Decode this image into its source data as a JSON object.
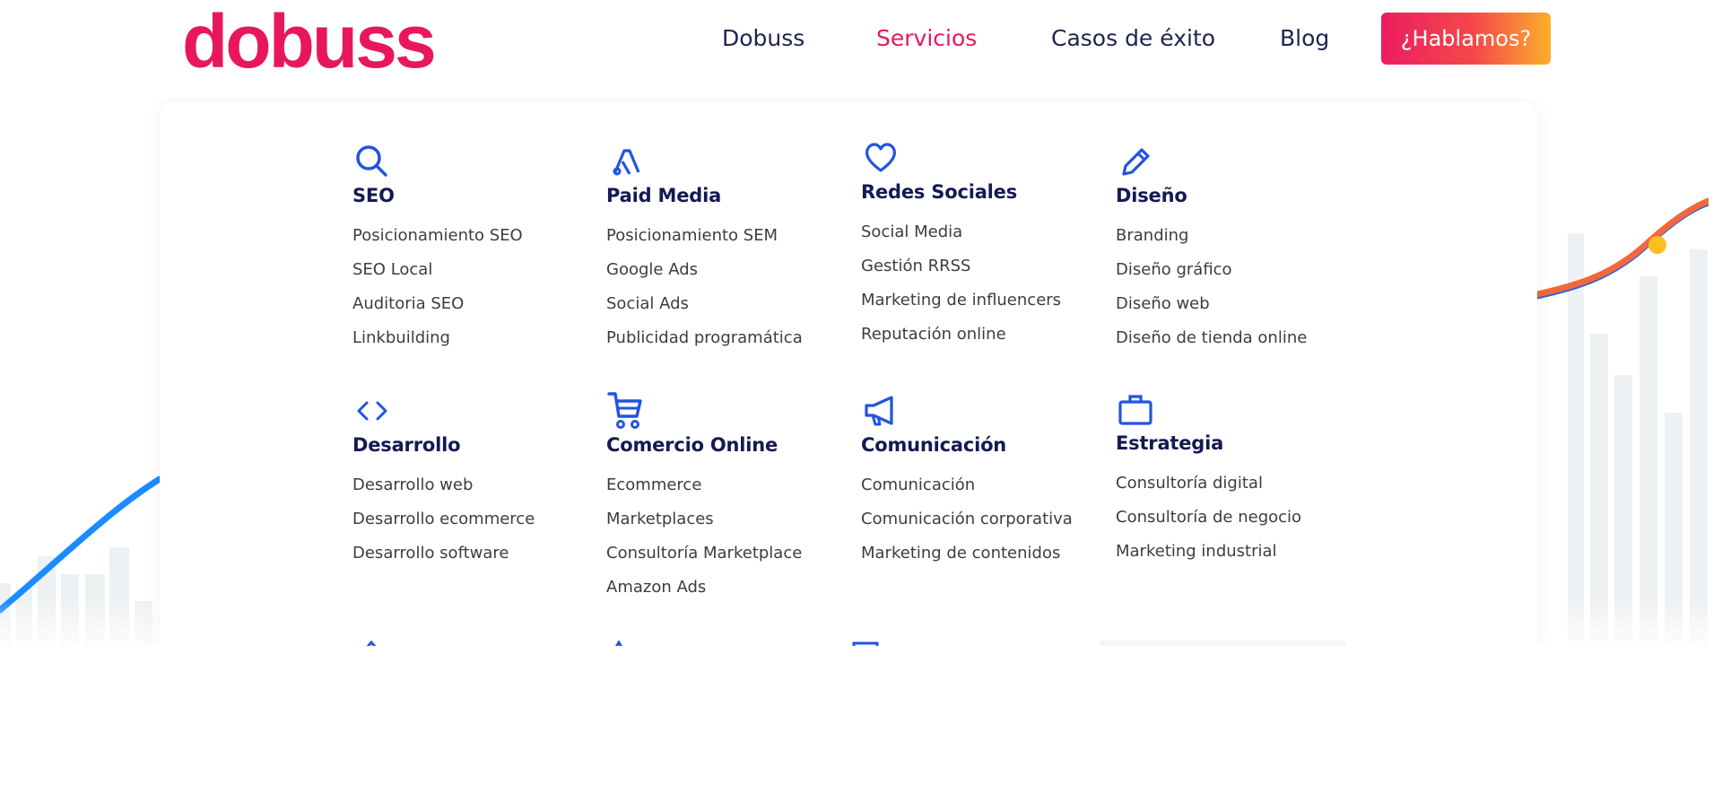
{
  "header": {
    "logo": "dobuss",
    "nav": [
      "Dobuss",
      "Servicios",
      "Casos de éxito",
      "Blog"
    ],
    "cta": "¿Hablamos?"
  },
  "colors": {
    "brand": "#e8175d",
    "navy": "#1f2350",
    "icon_blue": "#2155e0",
    "chart_blue": "#1a8cff",
    "chart_orange": "#f4673a",
    "dot": "#fcbf1e"
  },
  "menu": [
    {
      "icon": "search-icon",
      "title": "SEO",
      "items": [
        "Posicionamiento SEO",
        "SEO Local",
        "Auditoria SEO",
        "Linkbuilding"
      ]
    },
    {
      "icon": "google-ads-icon",
      "title": "Paid Media",
      "items": [
        "Posicionamiento SEM",
        "Google Ads",
        "Social Ads",
        "Publicidad programática"
      ]
    },
    {
      "icon": "heart-icon",
      "title": "Redes Sociales",
      "items": [
        "Social Media",
        "Gestión RRSS",
        "Marketing de influencers",
        "Reputación online"
      ]
    },
    {
      "icon": "pencil-icon",
      "title": "Diseño",
      "items": [
        "Branding",
        "Diseño gráfico",
        "Diseño web",
        "Diseño de tienda online"
      ]
    },
    {
      "icon": "code-icon",
      "title": "Desarrollo",
      "items": [
        "Desarrollo web",
        "Desarrollo ecommerce",
        "Desarrollo software"
      ]
    },
    {
      "icon": "cart-icon",
      "title": "Comercio Online",
      "items": [
        "Ecommerce",
        "Marketplaces",
        "Consultoría Marketplace",
        "Amazon Ads"
      ]
    },
    {
      "icon": "megaphone-icon",
      "title": "Comunicación",
      "items": [
        "Comunicación",
        "Comunicación corporativa",
        "Marketing de contenidos"
      ]
    },
    {
      "icon": "briefcase-icon",
      "title": "Estrategia",
      "items": [
        "Consultoría digital",
        "Consultoría de negocio",
        "Marketing industrial"
      ]
    }
  ]
}
